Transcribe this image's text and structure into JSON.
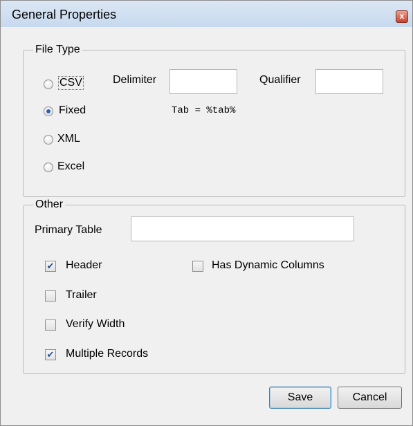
{
  "window": {
    "title": "General Properties",
    "close_label": "x"
  },
  "file_type": {
    "legend": "File Type",
    "options": [
      {
        "label": "CSV",
        "selected": false
      },
      {
        "label": "Fixed",
        "selected": true
      },
      {
        "label": "XML",
        "selected": false
      },
      {
        "label": "Excel",
        "selected": false
      }
    ],
    "delimiter_label": "Delimiter",
    "delimiter_value": "",
    "qualifier_label": "Qualifier",
    "qualifier_value": "",
    "tab_hint": "Tab = %tab%"
  },
  "other": {
    "legend": "Other",
    "primary_table_label": "Primary Table",
    "primary_table_value": "",
    "checkboxes": [
      {
        "label": "Header",
        "checked": true
      },
      {
        "label": "Trailer",
        "checked": false
      },
      {
        "label": "Verify Width",
        "checked": false
      },
      {
        "label": "Multiple Records",
        "checked": true
      },
      {
        "label": "Has Dynamic Columns",
        "checked": false
      }
    ]
  },
  "buttons": {
    "save": "Save",
    "cancel": "Cancel"
  }
}
